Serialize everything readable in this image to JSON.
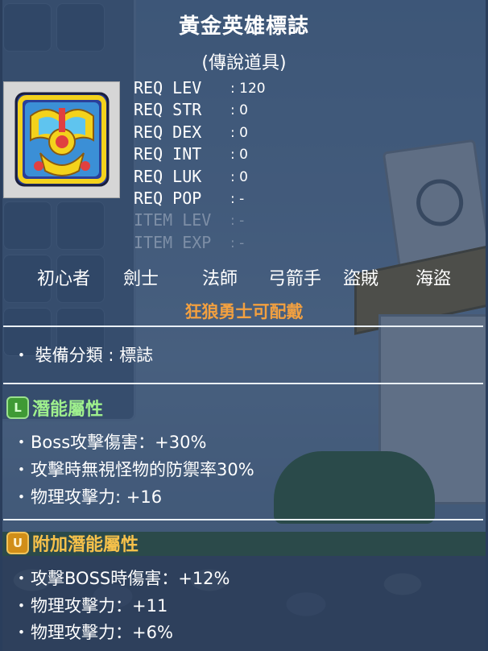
{
  "item": {
    "name": "黃金英雄標誌",
    "rarity": "(傳說道具)",
    "icon": "golden-hero-emblem-icon"
  },
  "requirements": [
    {
      "label": "REQ LEV",
      "value": "120",
      "dim": false
    },
    {
      "label": "REQ STR",
      "value": "0",
      "dim": false
    },
    {
      "label": "REQ DEX",
      "value": "0",
      "dim": false
    },
    {
      "label": "REQ INT",
      "value": "0",
      "dim": false
    },
    {
      "label": "REQ LUK",
      "value": "0",
      "dim": false
    },
    {
      "label": "REQ POP",
      "value": "-",
      "dim": false
    },
    {
      "label": "ITEM LEV",
      "value": "-",
      "dim": true
    },
    {
      "label": "ITEM EXP",
      "value": "-",
      "dim": true
    }
  ],
  "jobs": [
    "初心者",
    "劍士",
    "法師",
    "弓箭手",
    "盜賊",
    "海盜"
  ],
  "restriction": "狂狼勇士可配戴",
  "category": "・ 裝備分類 : 標誌",
  "potential": {
    "badge": "L",
    "title": "潛能屬性",
    "lines": [
      "Boss攻擊傷害：+30%",
      "攻擊時無視怪物的防禦率30%",
      "物理攻擊力: +16"
    ]
  },
  "bonus_potential": {
    "badge": "U",
    "title": "附加潛能屬性",
    "lines": [
      "攻擊BOSS時傷害：+12%",
      "物理攻擊力：+11",
      "物理攻擊力：+6%"
    ]
  },
  "colors": {
    "title": "#ffffff",
    "restriction": "#f2a040",
    "legendary_green": "#9ff08d",
    "unique_gold": "#f6c14a",
    "dim_text": "#7d8ea6"
  }
}
